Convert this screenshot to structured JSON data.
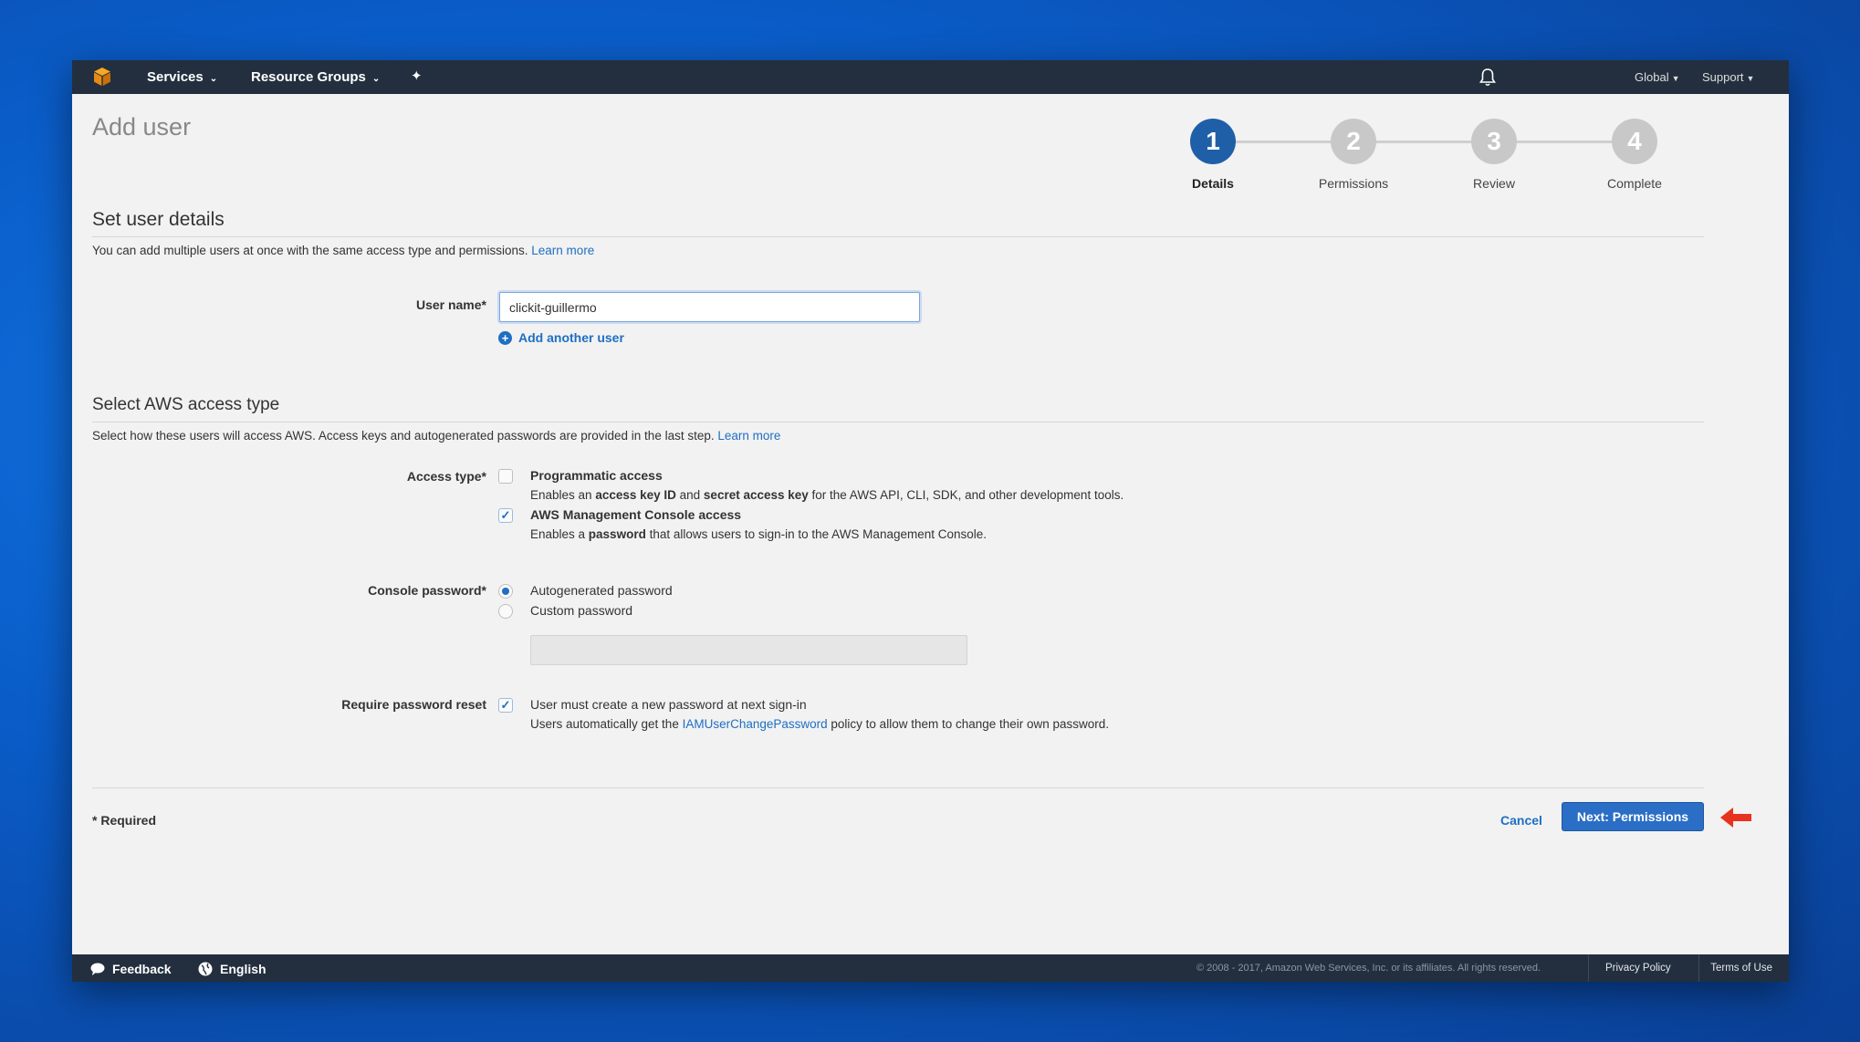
{
  "topnav": {
    "services": "Services",
    "resource_groups": "Resource Groups",
    "global": "Global",
    "support": "Support"
  },
  "page": {
    "title": "Add user"
  },
  "stepper": {
    "steps": [
      {
        "number": "1",
        "label": "Details",
        "active": true
      },
      {
        "number": "2",
        "label": "Permissions",
        "active": false
      },
      {
        "number": "3",
        "label": "Review",
        "active": false
      },
      {
        "number": "4",
        "label": "Complete",
        "active": false
      }
    ]
  },
  "details": {
    "title": "Set user details",
    "description": "You can add multiple users at once with the same access type and permissions.",
    "learn_more": "Learn more",
    "username_label": "User name*",
    "username_value": "clickit-guillermo",
    "add_another": "Add another user"
  },
  "access": {
    "title": "Select AWS access type",
    "description": "Select how these users will access AWS. Access keys and autogenerated passwords are provided in the last step.",
    "learn_more": "Learn more",
    "access_type_label": "Access type*",
    "programmatic": {
      "label": "Programmatic access",
      "desc_pre": "Enables an ",
      "desc_b1": "access key ID",
      "desc_mid": " and ",
      "desc_b2": "secret access key",
      "desc_post": " for the AWS API, CLI, SDK, and other development tools.",
      "checked": false
    },
    "console": {
      "label": "AWS Management Console access",
      "desc_pre": "Enables a ",
      "desc_b1": "password",
      "desc_post": " that allows users to sign-in to the AWS Management Console.",
      "checked": true
    },
    "console_password_label": "Console password*",
    "autogen": "Autogenerated password",
    "custom": "Custom password",
    "reset_label": "Require password reset",
    "reset_text": "User must create a new password at next sign-in",
    "reset_sub_pre": "Users automatically get the ",
    "reset_sub_link": "IAMUserChangePassword",
    "reset_sub_post": " policy to allow them to change their own password."
  },
  "actions": {
    "required": "* Required",
    "cancel": "Cancel",
    "next": "Next: Permissions"
  },
  "footer": {
    "feedback": "Feedback",
    "language": "English",
    "copyright": "© 2008 - 2017, Amazon Web Services, Inc. or its affiliates. All rights reserved.",
    "privacy": "Privacy Policy",
    "terms": "Terms of Use"
  },
  "colors": {
    "primary": "#2a6ec6",
    "active_step": "#1f5fa8",
    "link": "#1e6fc2",
    "nav_bg": "#232f3e",
    "arrow": "#e8321e"
  }
}
